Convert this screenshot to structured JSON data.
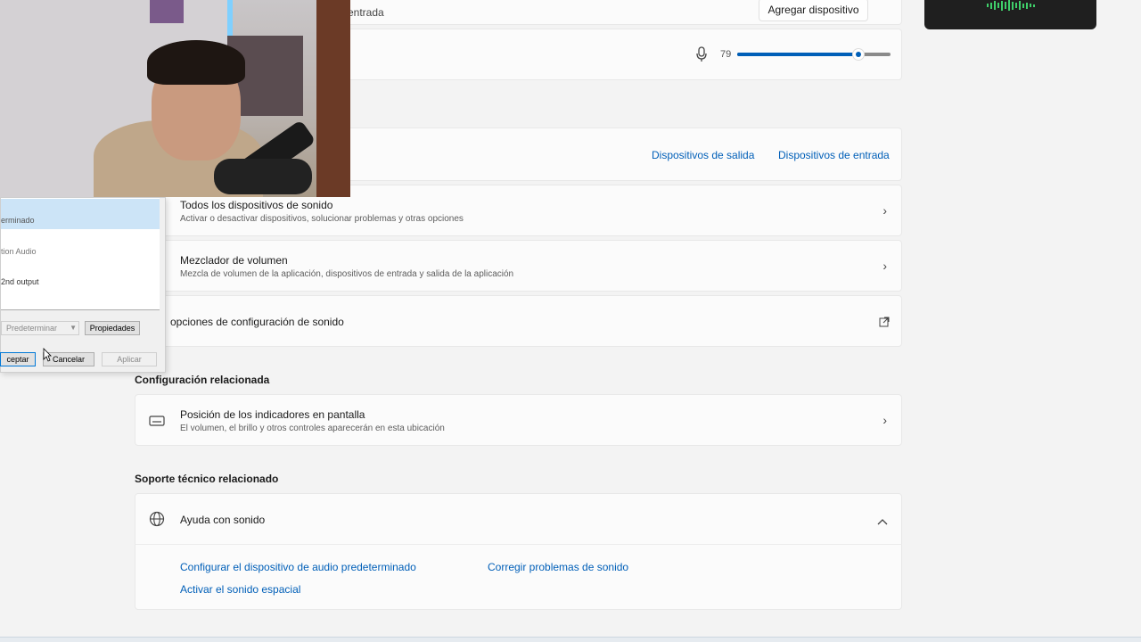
{
  "top_row": {
    "partial_label": "entrada",
    "add_device_button": "Agregar dispositivo"
  },
  "input_volume": {
    "icon": "microphone-icon",
    "value": "79",
    "level_percent": 79
  },
  "device_tabs": {
    "output": "Dispositivos de salida",
    "input": "Dispositivos de entrada"
  },
  "rows": {
    "all_devices": {
      "title": "Todos los dispositivos de sonido",
      "subtitle": "Activar o desactivar dispositivos, solucionar problemas y otras opciones"
    },
    "mixer": {
      "title": "Mezclador de volumen",
      "subtitle": "Mezcla de volumen de la aplicación, dispositivos de entrada y salida de la aplicación"
    },
    "more_options": {
      "title": "opciones de configuración de sonido"
    }
  },
  "related_config": {
    "heading": "Configuración relacionada",
    "indicator_position": {
      "title": "Posición de los indicadores en pantalla",
      "subtitle": "El volumen, el brillo y otros controles aparecerán en esta ubicación"
    }
  },
  "related_support": {
    "heading": "Soporte técnico relacionado",
    "help": {
      "title": "Ayuda con sonido",
      "links": {
        "configure": "Configurar el dispositivo de audio predeterminado",
        "fix": "Corregir problemas de sonido",
        "spatial": "Activar el sonido espacial"
      }
    }
  },
  "legacy_dialog": {
    "items": [
      "erminado",
      "tion Audio",
      "2nd output"
    ],
    "default_button": "Predeterminar",
    "properties_button": "Propiedades",
    "accept_button": "ceptar",
    "cancel_button": "Cancelar",
    "apply_button": "Aplicar"
  },
  "colors": {
    "accent": "#005fb8",
    "background": "#f3f3f3",
    "card": "#fbfbfb"
  }
}
